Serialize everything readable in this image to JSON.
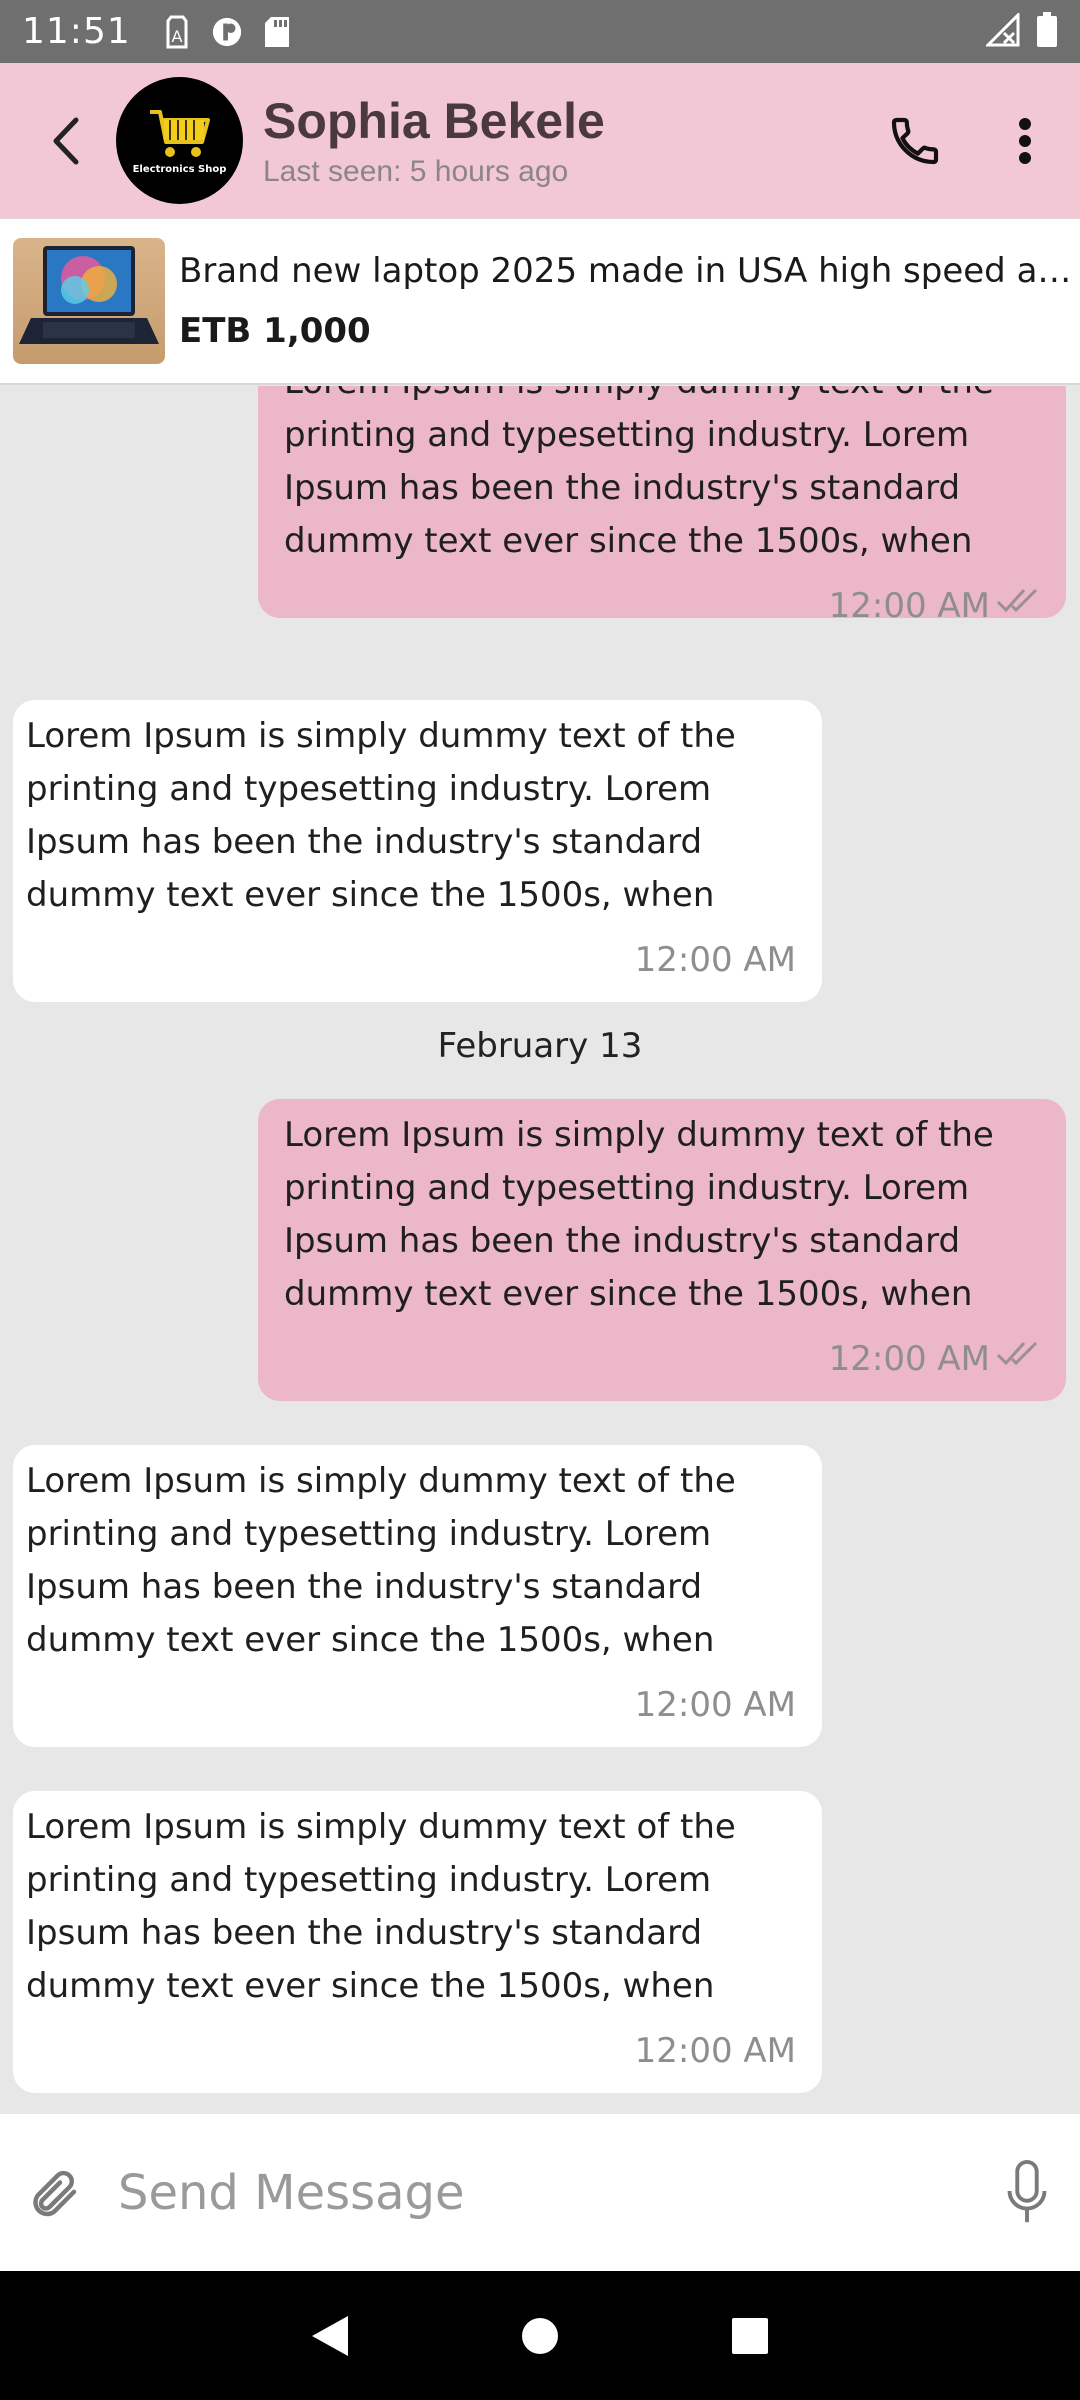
{
  "status_bar": {
    "time": "11:51",
    "icons_left": [
      "text-a-icon",
      "circle-p-icon",
      "sd-card-icon"
    ],
    "icons_right": [
      "signal-x-icon",
      "battery-icon"
    ]
  },
  "header": {
    "contact_name": "Sophia Bekele",
    "last_seen": "Last seen: 5 hours ago",
    "avatar_label": "Electronics Shop",
    "background_color": "#f2c8d6"
  },
  "product": {
    "title": "Brand new laptop 2025 made in USA high speed an...",
    "price": "ETB 1,000"
  },
  "messages": [
    {
      "direction": "out",
      "text": "Lorem Ipsum is simply dummy text of the printing and typesetting industry. Lorem Ipsum has been the industry's standard dummy text ever since the 1500s, when",
      "time": "12:00 AM",
      "read": true
    },
    {
      "direction": "in",
      "text": "Lorem Ipsum is simply dummy text of the printing and typesetting industry. Lorem Ipsum has been the industry's standard dummy text ever since the 1500s, when",
      "time": "12:00 AM"
    },
    {
      "direction": "out",
      "text": "Lorem Ipsum is simply dummy text of the printing and typesetting industry. Lorem Ipsum has been the industry's standard dummy text ever since the 1500s, when",
      "time": "12:00 AM",
      "read": true
    },
    {
      "direction": "in",
      "text": "Lorem Ipsum is simply dummy text of the printing and typesetting industry. Lorem Ipsum has been the industry's standard dummy text ever since the 1500s, when",
      "time": "12:00 AM"
    },
    {
      "direction": "in",
      "text": "Lorem Ipsum is simply dummy text of the printing and typesetting industry. Lorem Ipsum has been the industry's standard dummy text ever since the 1500s, when",
      "time": "12:00 AM"
    }
  ],
  "date_separator": "February 13",
  "composer": {
    "placeholder": "Send Message"
  },
  "colors": {
    "outgoing_bubble": "#ecb7c8",
    "incoming_bubble": "#ffffff",
    "chat_background": "#e7e7e7"
  }
}
